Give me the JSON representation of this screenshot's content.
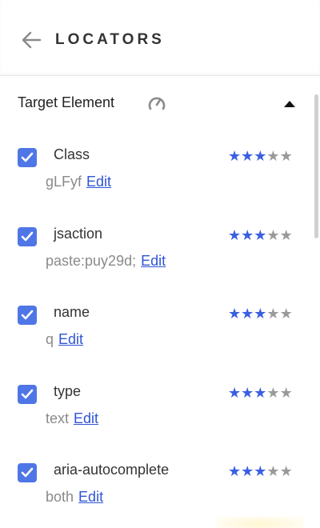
{
  "header": {
    "title": "LOCATORS",
    "back_icon": "arrow-left-icon"
  },
  "section": {
    "title": "Target Element",
    "icon": "gauge-icon",
    "toggle_icon": "triangle-up-icon",
    "expanded": true
  },
  "colors": {
    "checkbox": "#4f76e6",
    "star_on": "#3a5fe0",
    "star_off": "#9a9a9a",
    "link": "#2f55d4"
  },
  "locators": [
    {
      "name": "Class",
      "value": "gLFyf",
      "edit": "Edit",
      "checked": true,
      "rating": 3,
      "max_rating": 5
    },
    {
      "name": "jsaction",
      "value": "paste:puy29d;",
      "edit": "Edit",
      "checked": true,
      "rating": 3,
      "max_rating": 5
    },
    {
      "name": "name",
      "value": "q",
      "edit": "Edit",
      "checked": true,
      "rating": 3,
      "max_rating": 5
    },
    {
      "name": "type",
      "value": "text",
      "edit": "Edit",
      "checked": true,
      "rating": 3,
      "max_rating": 5
    },
    {
      "name": "aria-autocomplete",
      "value": "both",
      "edit": "Edit",
      "checked": true,
      "rating": 3,
      "max_rating": 5
    }
  ]
}
